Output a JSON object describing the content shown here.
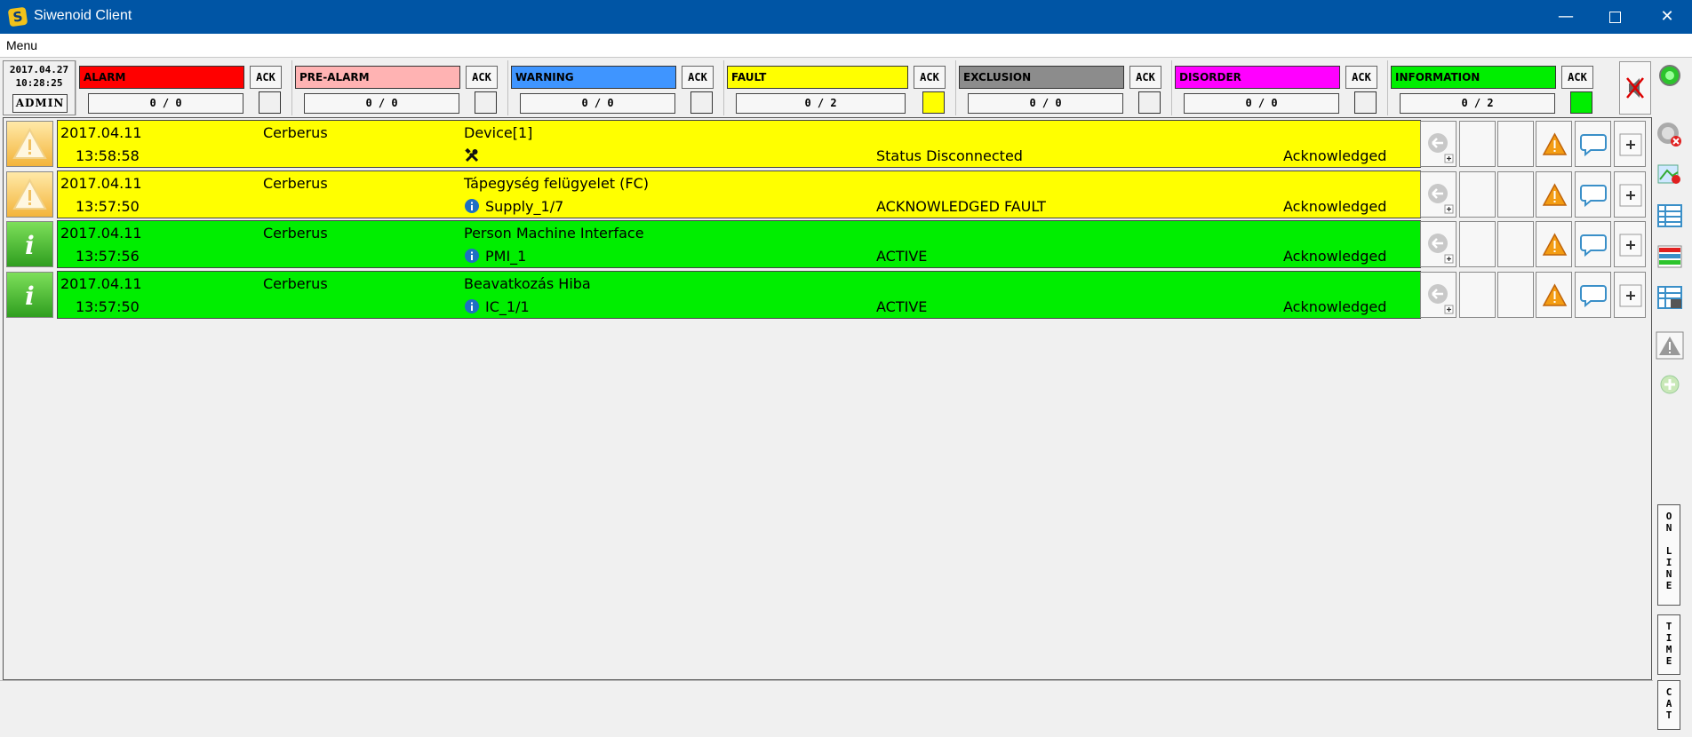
{
  "window": {
    "title": "Siwenoid Client",
    "logo_glyph": "S"
  },
  "menu": {
    "label": "Menu"
  },
  "header": {
    "date": "2017.04.27",
    "time": "10:28:25",
    "user_button": "ADMIN",
    "categories": [
      {
        "label": "ALARM",
        "color": "#ff0000",
        "ack": "ACK",
        "count": "0 / 0",
        "indicator": "#f0f0f0"
      },
      {
        "label": "PRE-ALARM",
        "color": "#ffb3b3",
        "ack": "ACK",
        "count": "0 / 0",
        "indicator": "#f0f0f0"
      },
      {
        "label": "WARNING",
        "color": "#3f95ff",
        "ack": "ACK",
        "count": "0 / 0",
        "indicator": "#f0f0f0"
      },
      {
        "label": "FAULT",
        "color": "#ffff00",
        "ack": "ACK",
        "count": "0 / 2",
        "indicator": "#ffff00"
      },
      {
        "label": "EXCLUSION",
        "color": "#8c8c8c",
        "ack": "ACK",
        "count": "0 / 0",
        "indicator": "#f0f0f0"
      },
      {
        "label": "DISORDER",
        "color": "#ff00ff",
        "ack": "ACK",
        "count": "0 / 0",
        "indicator": "#f0f0f0"
      },
      {
        "label": "INFORMATION",
        "color": "#00ee00",
        "ack": "ACK",
        "count": "0 / 2",
        "indicator": "#00ee00"
      }
    ]
  },
  "events": [
    {
      "type": "fault",
      "color": "#ffff00",
      "date": "2017.04.11",
      "time": "13:58:58",
      "source": "Cerberus",
      "name": "Device[1]",
      "sub_icon": "tools-icon",
      "sub": "",
      "status": "Status Disconnected",
      "ack": "Acknowledged"
    },
    {
      "type": "fault",
      "color": "#ffff00",
      "date": "2017.04.11",
      "time": "13:57:50",
      "source": "Cerberus",
      "name": "Tápegység felügyelet (FC)",
      "sub_icon": "info-icon",
      "sub": "Supply_1/7",
      "status": "ACKNOWLEDGED FAULT",
      "ack": "Acknowledged"
    },
    {
      "type": "information",
      "color": "#00ee00",
      "date": "2017.04.11",
      "time": "13:57:56",
      "source": "Cerberus",
      "name": "Person Machine Interface",
      "sub_icon": "info-icon",
      "sub": "PMI_1",
      "status": "ACTIVE",
      "ack": "Acknowledged"
    },
    {
      "type": "information",
      "color": "#00ee00",
      "date": "2017.04.11",
      "time": "13:57:50",
      "source": "Cerberus",
      "name": "Beavatkozás Hiba",
      "sub_icon": "info-icon",
      "sub": "IC_1/1",
      "status": "ACTIVE",
      "ack": "Acknowledged"
    }
  ],
  "side_tabs": {
    "online": [
      "O",
      "N",
      "",
      "L",
      "I",
      "N",
      "E"
    ],
    "time": [
      "T",
      "I",
      "M",
      "E"
    ],
    "cat": [
      "C",
      "A",
      "T"
    ]
  }
}
